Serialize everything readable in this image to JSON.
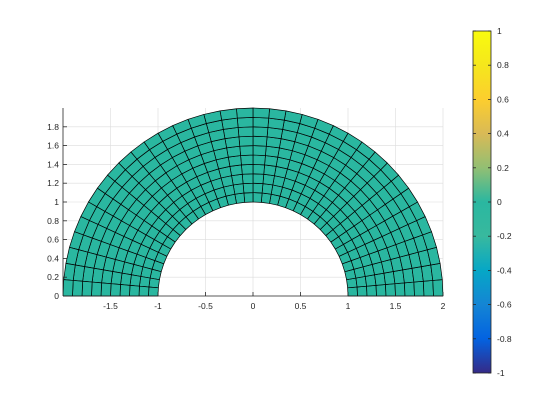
{
  "chart_data": {
    "type": "heatmap",
    "title": "",
    "xlabel": "",
    "ylabel": "",
    "xlim": [
      -2,
      2
    ],
    "ylim": [
      0,
      2
    ],
    "grid": true,
    "mesh": {
      "shape": "half-annulus",
      "inner_radius": 1,
      "outer_radius": 2,
      "theta_range_deg": [
        0,
        180
      ],
      "radial_divisions": 10,
      "angular_divisions": 36,
      "field_value": 0
    },
    "x_ticks": [
      "-1.5",
      "-1",
      "-0.5",
      "0",
      "0.5",
      "1",
      "1.5",
      "2"
    ],
    "x_tick_values": [
      -1.5,
      -1,
      -0.5,
      0,
      0.5,
      1,
      1.5,
      2
    ],
    "y_ticks": [
      "0",
      "0.2",
      "0.4",
      "0.6",
      "0.8",
      "1",
      "1.2",
      "1.4",
      "1.6",
      "1.8"
    ],
    "y_tick_values": [
      0,
      0.2,
      0.4,
      0.6,
      0.8,
      1,
      1.2,
      1.4,
      1.6,
      1.8
    ],
    "colorbar": {
      "colormap": "parula",
      "clim": [
        -1,
        1
      ],
      "ticks": [
        "-1",
        "-0.8",
        "-0.6",
        "-0.4",
        "-0.2",
        "0",
        "0.2",
        "0.4",
        "0.6",
        "0.8",
        "1"
      ],
      "tick_values": [
        -1,
        -0.8,
        -0.6,
        -0.4,
        -0.2,
        0,
        0.2,
        0.4,
        0.6,
        0.8,
        1
      ]
    },
    "colors": {
      "fill": "#2ab7a0",
      "edge": "#000000",
      "grid": "#dcdcdc",
      "axis": "#262626"
    }
  }
}
